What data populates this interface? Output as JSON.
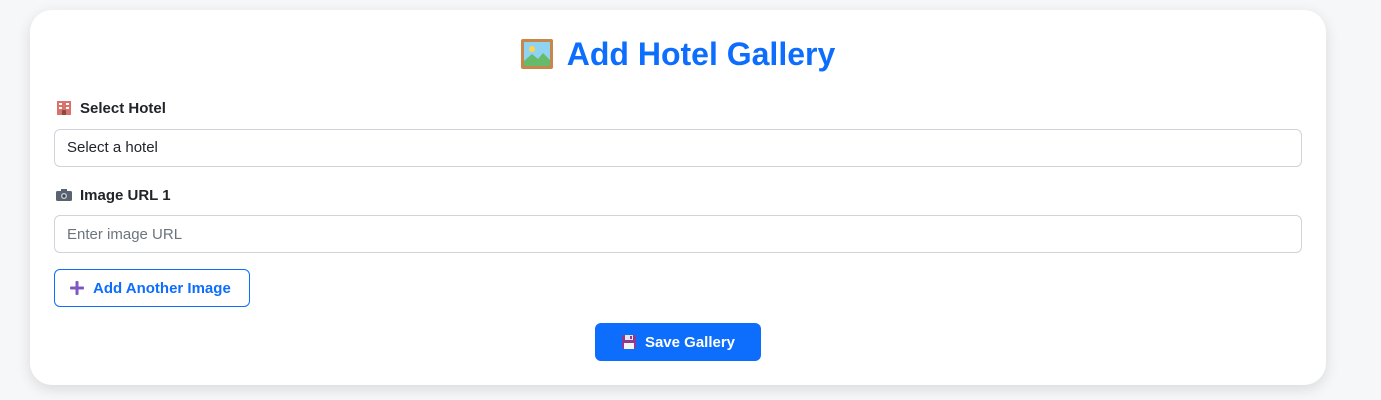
{
  "title": "Add Hotel Gallery",
  "title_icon": "framed-picture-icon",
  "hotel": {
    "label": "Select Hotel",
    "icon": "hotel-building-icon",
    "selected": "Select a hotel"
  },
  "image_url": {
    "label": "Image URL 1",
    "icon": "camera-icon",
    "value": "",
    "placeholder": "Enter image URL"
  },
  "buttons": {
    "add_another": "Add Another Image",
    "add_icon": "plus-icon",
    "save": "Save Gallery",
    "save_icon": "floppy-disk-icon"
  },
  "colors": {
    "accent": "#0d6efd",
    "plus_icon": "#7e57c2",
    "floppy_icon": "#8e3b8f"
  }
}
